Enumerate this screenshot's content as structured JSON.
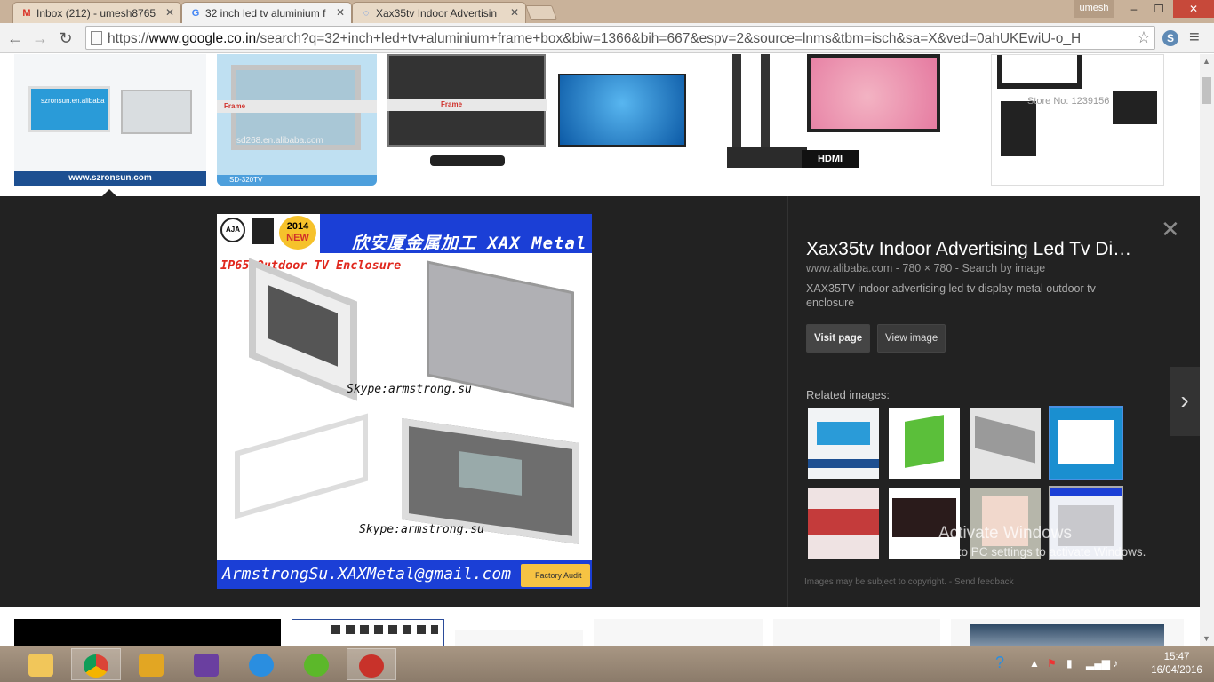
{
  "browser": {
    "tabs": [
      {
        "title": "Inbox (212) - umesh8765",
        "favicon": "gmail-icon",
        "active": false
      },
      {
        "title": "32 inch led tv aluminium f",
        "favicon": "google-icon",
        "active": true
      },
      {
        "title": "Xax35tv Indoor Advertisin",
        "favicon": "loading-icon",
        "active": false
      }
    ],
    "profile_name": "umesh",
    "url_prefix": "https://",
    "url_host": "www.google.co.in",
    "url_path": "/search?q=32+inch+led+tv+aluminium+frame+box&biw=1366&bih=667&espv=2&source=lnms&tbm=isch&sa=X&ved=0ahUKEwiU-o_H",
    "window_controls": {
      "minimize": "–",
      "restore": "❐",
      "close": "✕"
    }
  },
  "results_top_row": [
    {
      "caption": "www.szronsun.com",
      "watermark": "szronsun.en.alibaba"
    },
    {
      "caption": "SD-320TV",
      "watermark": "sd268.en.alibaba.com",
      "overlay": "Frame"
    },
    {
      "caption": "",
      "overlay": "Frame"
    },
    {
      "caption": ""
    },
    {
      "caption": "",
      "badge": "HDMI"
    },
    {
      "caption": "",
      "watermark": "Store No: 1239156"
    }
  ],
  "preview": {
    "image": {
      "header_text": "欣安厦金属加工 XAX Metal",
      "badge_year": "2014",
      "badge_new": "NEW",
      "badge_cert": "AJA",
      "subtitle": "IP65 Outdoor TV Enclosure",
      "skype_1": "Skype:armstrong.su",
      "skype_2": "Skype:armstrong.su",
      "email": "ArmstrongSu.XAXMetal@gmail.com",
      "audit": "Factory Audit"
    },
    "title": "Xax35tv Indoor Advertising Led Tv Di…",
    "meta": "www.alibaba.com - 780 × 780 - Search by image",
    "description": "XAX35TV indoor advertising led tv display metal outdoor tv enclosure",
    "visit_label": "Visit page",
    "view_label": "View image",
    "related_label": "Related images:",
    "copyright": "Images may be subject to copyright. - Send feedback"
  },
  "activate_windows": {
    "title": "Activate Windows",
    "subtitle": "Go to PC settings to activate Windows."
  },
  "taskbar": {
    "apps": [
      "file-explorer",
      "chrome",
      "winrar",
      "visual-studio",
      "internet-explorer",
      "utorrent",
      "video-downloader"
    ],
    "time": "15:47",
    "date": "16/04/2016"
  },
  "colors": {
    "title_bar": "#c9b29a",
    "preview_bg": "#222222",
    "image_blue": "#1b3fd6",
    "taskbar": "#9a8876"
  }
}
